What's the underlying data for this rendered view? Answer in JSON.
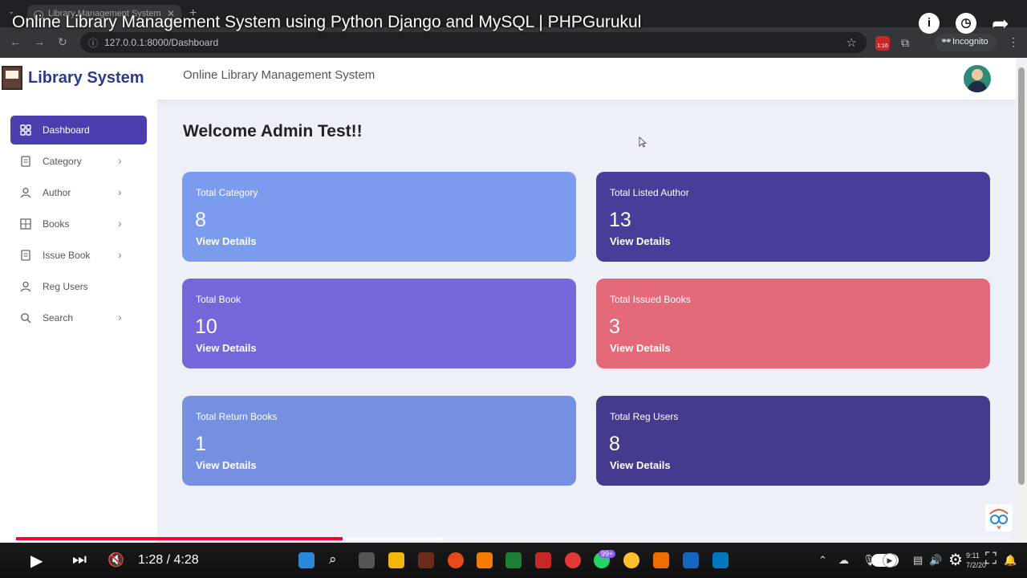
{
  "browser": {
    "tab_title": "Library Management System",
    "url": "127.0.0.1:8000/Dashboard",
    "incognito_label": "Incognito",
    "extension_badge": "1:16"
  },
  "video": {
    "title": "Online Library Management System using Python Django and MySQL | PHPGurukul",
    "time_display": "1:28 / 4:28",
    "progress_fraction": 0.328,
    "buffer_fraction": 0.428,
    "notification_badge": "99+",
    "clock_time": "9:11",
    "clock_date": "7/2/20"
  },
  "app": {
    "brand": "Library System",
    "header_title": "Online Library Management System",
    "welcome": "Welcome Admin Test!!"
  },
  "sidebar": {
    "items": [
      {
        "label": "Dashboard",
        "icon": "grid-icon",
        "active": true
      },
      {
        "label": "Category",
        "icon": "document-icon"
      },
      {
        "label": "Author",
        "icon": "user-icon"
      },
      {
        "label": "Books",
        "icon": "table-icon"
      },
      {
        "label": "Issue Book",
        "icon": "document-icon"
      },
      {
        "label": "Reg Users",
        "icon": "user-icon"
      },
      {
        "label": "Search",
        "icon": "search-icon"
      }
    ]
  },
  "cards": [
    {
      "title": "Total Category",
      "value": "8",
      "link": "View Details",
      "color": "#7b9bef"
    },
    {
      "title": "Total Listed Author",
      "value": "13",
      "link": "View Details",
      "color": "#473e9a"
    },
    {
      "title": "Total Book",
      "value": "10",
      "link": "View Details",
      "color": "#7467da"
    },
    {
      "title": "Total Issued Books",
      "value": "3",
      "link": "View Details",
      "color": "#e46a7a"
    },
    {
      "title": "Total Return Books",
      "value": "1",
      "link": "View Details",
      "color": "#7590e0"
    },
    {
      "title": "Total Reg Users",
      "value": "8",
      "link": "View Details",
      "color": "#443b8e"
    }
  ]
}
